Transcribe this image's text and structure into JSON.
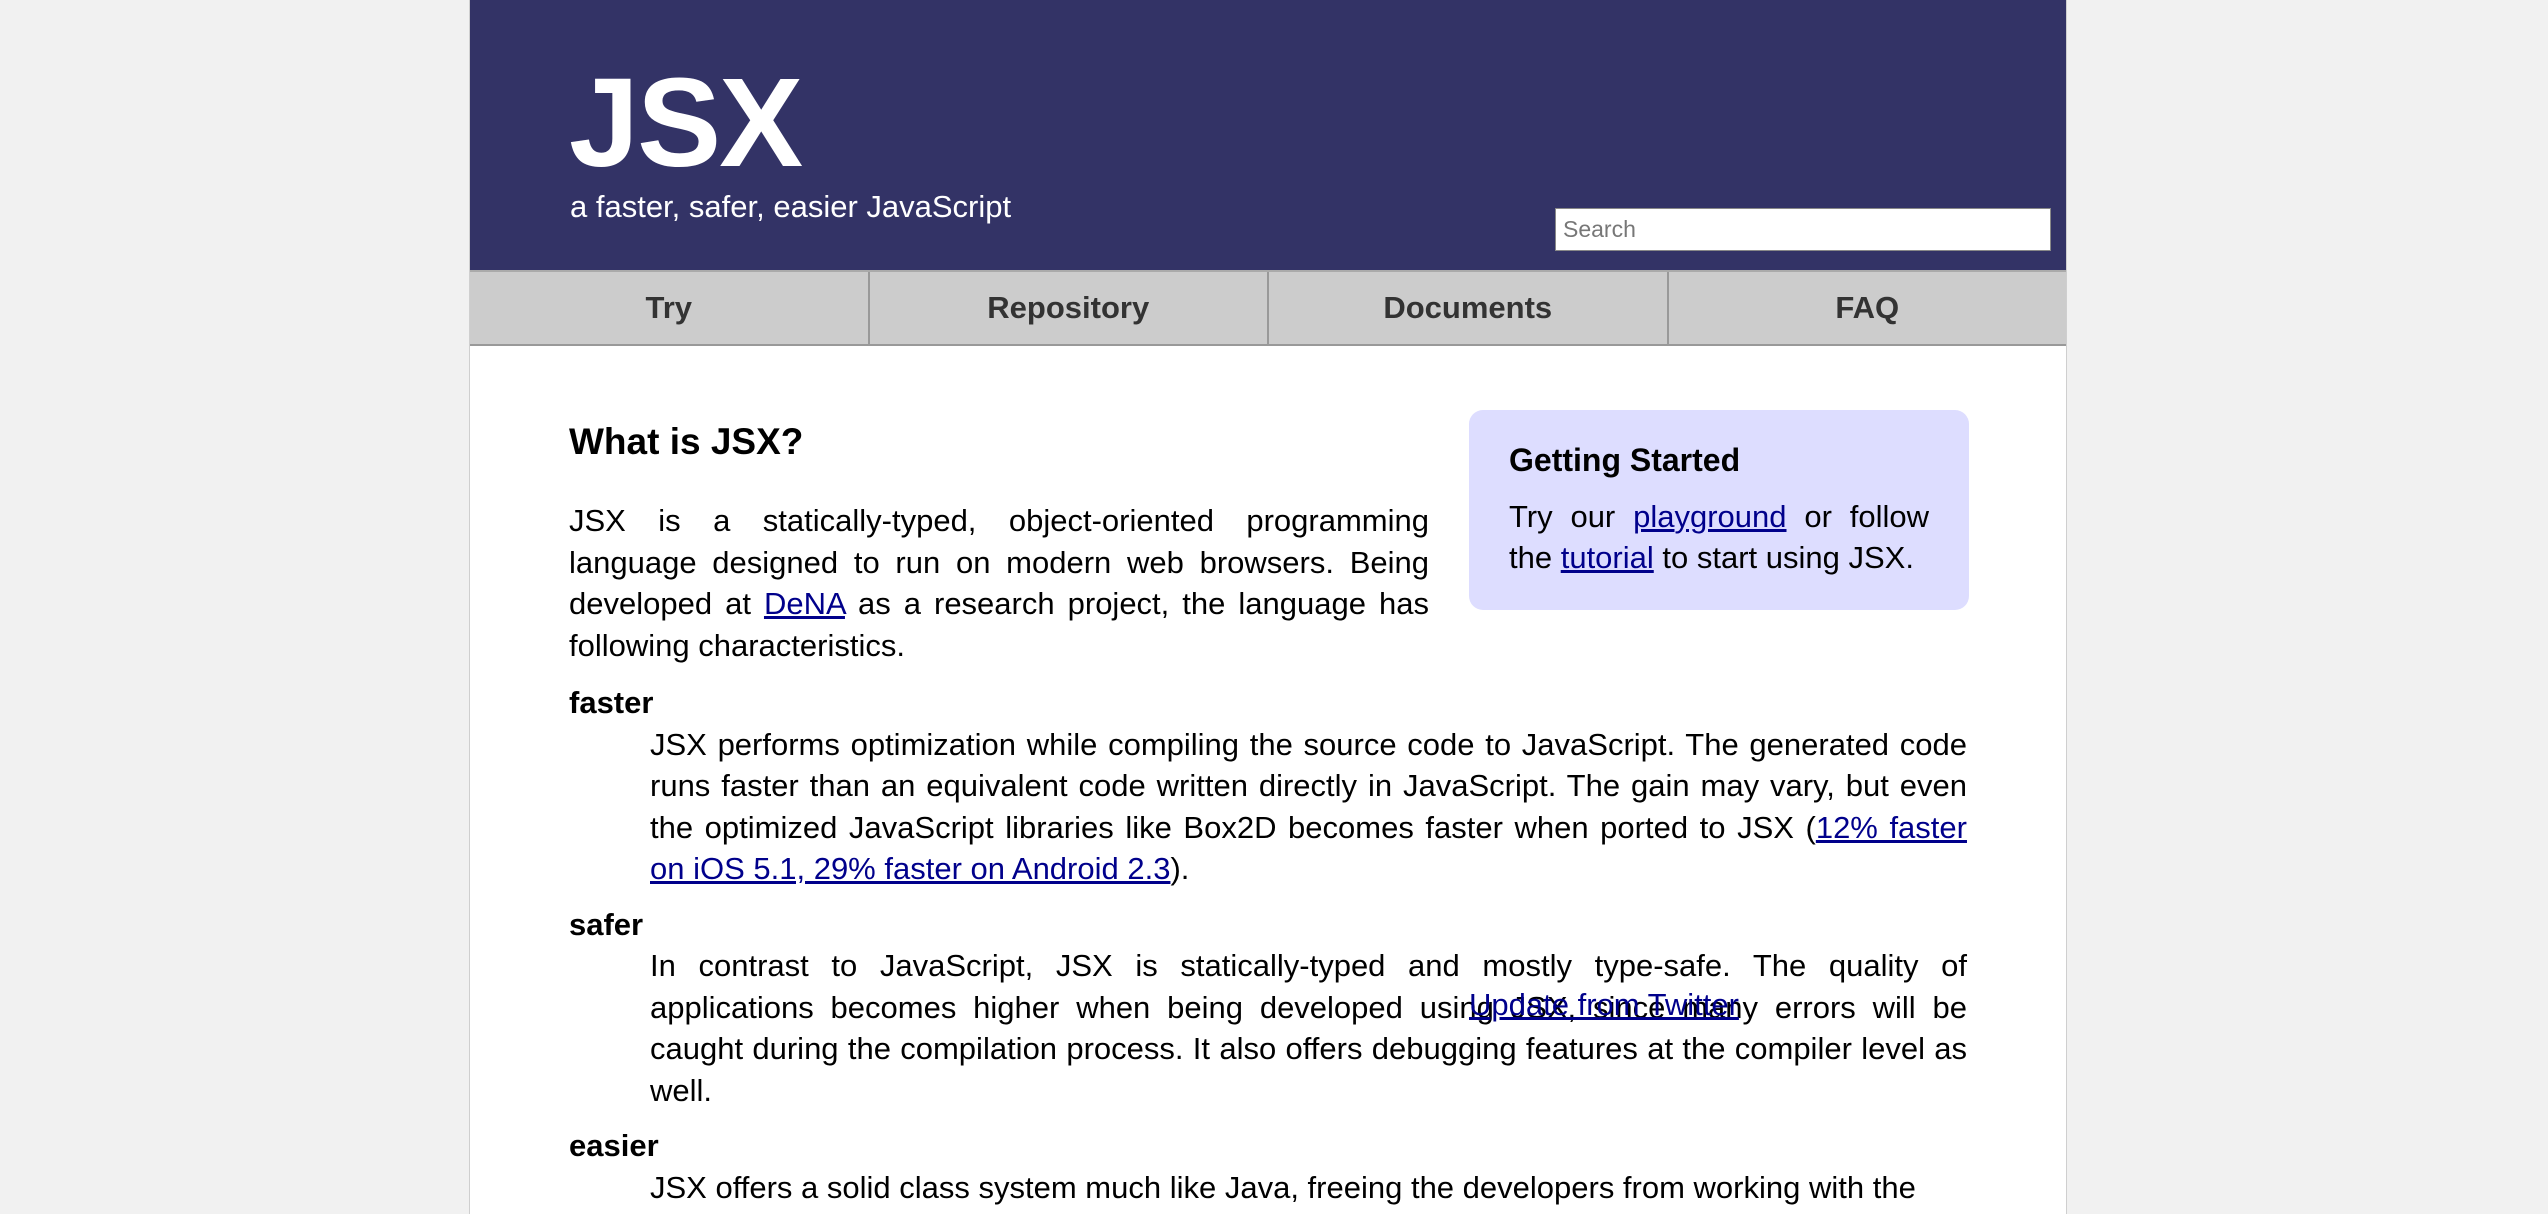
{
  "header": {
    "logo": "JSX",
    "tagline": "a faster, safer, easier JavaScript",
    "search_placeholder": "Search"
  },
  "nav": {
    "items": [
      {
        "label": "Try"
      },
      {
        "label": "Repository"
      },
      {
        "label": "Documents"
      },
      {
        "label": "FAQ"
      }
    ]
  },
  "intro": {
    "title": "What is JSX?",
    "text_before_link": "JSX is a statically-typed, object-oriented programming language designed to run on modern web browsers. Being developed at ",
    "link_label": "DeNA",
    "text_after_link": " as a research project, the language has following characteristics."
  },
  "sidebar": {
    "title": "Getting Started",
    "text_1": "Try our ",
    "playground_link": "playground",
    "text_2": " or follow the ",
    "tutorial_link": "tutorial",
    "text_3": " to start using JSX.",
    "twitter_link": "Update from Twitter"
  },
  "features": {
    "faster": {
      "term": "faster",
      "text": "JSX performs optimization while compiling the source code to JavaScript. The generated code runs faster than an equivalent code written directly in JavaScript. The gain may vary, but even the optimized JavaScript libraries like Box2D becomes faster when ported to JSX (",
      "link": "12% faster on iOS 5.1, 29% faster on Android 2.3",
      "text_end": ")."
    },
    "safer": {
      "term": "safer",
      "text": "In contrast to JavaScript, JSX is statically-typed and mostly type-safe. The quality of applications becomes higher when being developed using JSX, since many errors will be caught during the compilation process. It also offers debugging features at the compiler level as well."
    },
    "easier": {
      "term": "easier",
      "text": "JSX offers a solid class system much like Java, freeing the developers from working with the"
    }
  },
  "colors": {
    "header_bg": "#333366",
    "nav_bg": "#cccccc",
    "sidebar_bg": "#ddddff",
    "link": "#00008b"
  }
}
